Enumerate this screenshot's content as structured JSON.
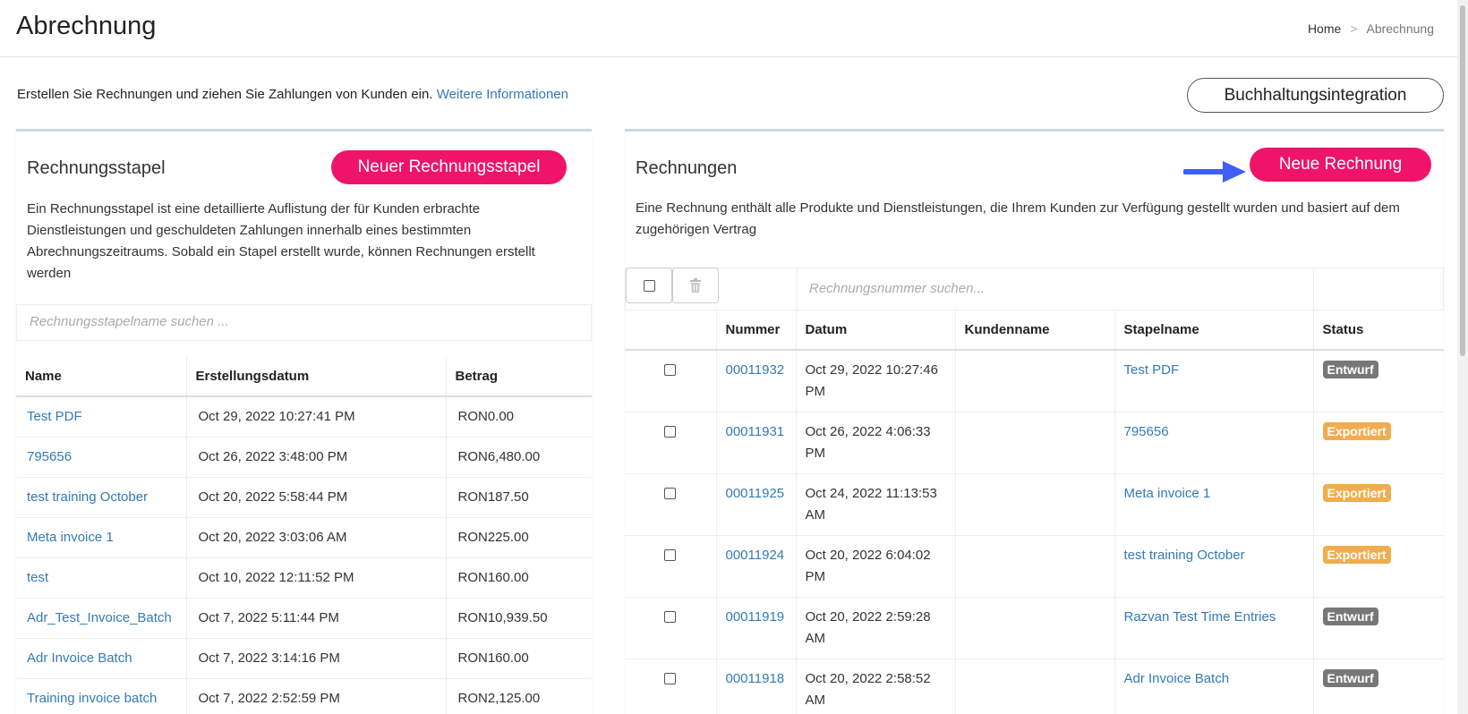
{
  "header": {
    "title": "Abrechnung",
    "breadcrumb": {
      "home": "Home",
      "separator": ">",
      "current": "Abrechnung"
    }
  },
  "intro": {
    "text": "Erstellen Sie Rechnungen und ziehen Sie Zahlungen von Kunden ein.",
    "link": "Weitere Informationen"
  },
  "accounting_button": "Buchhaltungsintegration",
  "batches": {
    "title": "Rechnungsstapel",
    "new_button": "Neuer Rechnungsstapel",
    "description": "Ein Rechnungsstapel ist eine detaillierte Auflistung der für Kunden erbrachte Dienstleistungen und geschuldeten Zahlungen innerhalb eines bestimmten Abrechnungszeitraums. Sobald ein Stapel erstellt wurde, können Rechnungen erstellt werden",
    "search_placeholder": "Rechnungsstapelname suchen ...",
    "columns": [
      "Name",
      "Erstellungsdatum",
      "Betrag"
    ],
    "rows": [
      {
        "name": "Test PDF",
        "date": "Oct 29, 2022 10:27:41 PM",
        "amount": "RON0.00"
      },
      {
        "name": "795656",
        "date": "Oct 26, 2022 3:48:00 PM",
        "amount": "RON6,480.00"
      },
      {
        "name": "test training October",
        "date": "Oct 20, 2022 5:58:44 PM",
        "amount": "RON187.50"
      },
      {
        "name": "Meta invoice 1",
        "date": "Oct 20, 2022 3:03:06 AM",
        "amount": "RON225.00"
      },
      {
        "name": "test",
        "date": "Oct 10, 2022 12:11:52 PM",
        "amount": "RON160.00"
      },
      {
        "name": "Adr_Test_Invoice_Batch",
        "date": "Oct 7, 2022 5:11:44 PM",
        "amount": "RON10,939.50"
      },
      {
        "name": "Adr Invoice Batch",
        "date": "Oct 7, 2022 3:14:16 PM",
        "amount": "RON160.00"
      },
      {
        "name": "Training invoice batch",
        "date": "Oct 7, 2022 2:52:59 PM",
        "amount": "RON2,125.00"
      }
    ]
  },
  "invoices": {
    "title": "Rechnungen",
    "new_button": "Neue Rechnung",
    "description": "Eine Rechnung enthält alle Produkte und Dienstleistungen, die Ihrem Kunden zur Verfügung gestellt wurden und basiert auf dem zugehörigen Vertrag",
    "search_placeholder": "Rechnungsnummer suchen...",
    "columns": [
      "Nummer",
      "Datum",
      "Kundenname",
      "Stapelname",
      "Status"
    ],
    "rows": [
      {
        "number": "00011932",
        "date": "Oct 29, 2022 10:27:46 PM",
        "customer": "",
        "batch": "Test PDF",
        "status": "Entwurf",
        "status_kind": "draft"
      },
      {
        "number": "00011931",
        "date": "Oct 26, 2022 4:06:33 PM",
        "customer": "",
        "batch": "795656",
        "status": "Exportiert",
        "status_kind": "exported"
      },
      {
        "number": "00011925",
        "date": "Oct 24, 2022 11:13:53 AM",
        "customer": "",
        "batch": "Meta invoice 1",
        "status": "Exportiert",
        "status_kind": "exported"
      },
      {
        "number": "00011924",
        "date": "Oct 20, 2022 6:04:02 PM",
        "customer": "",
        "batch": "test training October",
        "status": "Exportiert",
        "status_kind": "exported"
      },
      {
        "number": "00011919",
        "date": "Oct 20, 2022 2:59:28 AM",
        "customer": "",
        "batch": "Razvan Test Time Entries",
        "status": "Entwurf",
        "status_kind": "draft"
      },
      {
        "number": "00011918",
        "date": "Oct 20, 2022 2:58:52 AM",
        "customer": "",
        "batch": "Adr Invoice Batch",
        "status": "Entwurf",
        "status_kind": "draft"
      }
    ]
  },
  "icons": {
    "select_all": "checkbox-icon",
    "delete": "trash-icon",
    "pointer": "arrow-right-icon"
  },
  "colors": {
    "accent": "#f0136a",
    "link": "#337ab7",
    "draft": "#777777",
    "exported": "#f0ad4e",
    "arrow": "#3f5ef5"
  }
}
